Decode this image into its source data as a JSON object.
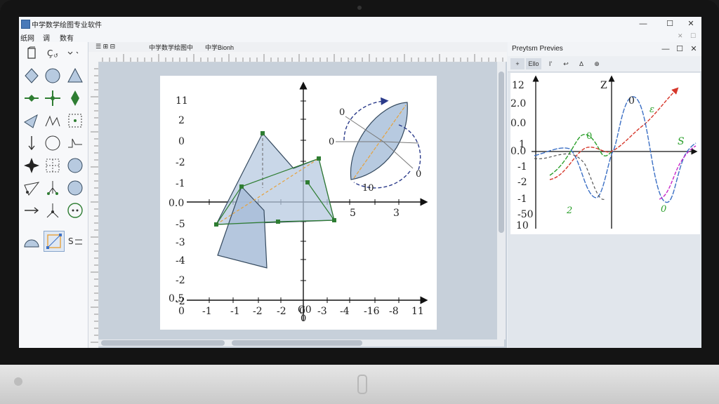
{
  "window": {
    "title": "中学数学绘图专业软件",
    "controls": {
      "minimize": "—",
      "maximize": "☐",
      "close": "✕"
    }
  },
  "menu": {
    "items": [
      "纸网",
      "调",
      "数有"
    ]
  },
  "doc": {
    "tabs": [
      "中学数学绘图中",
      "中学Bionh"
    ]
  },
  "tools": [
    "select-tool",
    "point-tool",
    "chevron-tool",
    "rhombus-tool",
    "circle-tool",
    "triangle-tool",
    "arrow-diamond-tool",
    "cross-tool",
    "diamond-tool",
    "parallelogram-tool",
    "angle-tool",
    "dotted-box-tool",
    "down-arrow-tool",
    "circle-outline-tool",
    "step-tool",
    "star-tool",
    "dashed-grid-tool",
    "filled-circle-tool",
    "triangle-outline-tool",
    "scatter-tool",
    "circle-tool-2",
    "right-arrow-tool",
    "branch-tool",
    "dotted-circle-tool",
    "semicircle-tool",
    "crop-tool",
    "transform-tool"
  ],
  "main_plot": {
    "y_labels_top": [
      "11",
      "2",
      "0",
      "-2",
      "-1",
      "0.0",
      "-5",
      "-3",
      "-4",
      "-2",
      "-2",
      "0.5"
    ],
    "x_labels_axis": [
      "5",
      "3"
    ],
    "x_labels_bottom": [
      "0",
      "-1",
      "-1",
      "-2",
      "-2",
      "0",
      "-3",
      "-4",
      "-16",
      "-8",
      "11"
    ],
    "x_label_zero": "0",
    "x_origin_label": "C0",
    "ellipse_labels": [
      "0",
      "0",
      "0",
      "10"
    ]
  },
  "preview": {
    "title": "Preytsm Previes",
    "tool_buttons": [
      "+",
      "Ello",
      "Ӏ'",
      "↩",
      "∆",
      "⊕"
    ],
    "y_labels": [
      "12",
      "2.0",
      "0.0",
      "1",
      "0.0",
      "-1",
      "-2",
      "-1",
      "-50",
      "10"
    ],
    "z_label": "Z",
    "curve_labels": {
      "top": "0",
      "green": "0",
      "red": "ε",
      "right": "S",
      "bottom_left": "2",
      "bottom_right": "0"
    }
  },
  "colors": {
    "fill": "#b7cae0",
    "stroke": "#34495e",
    "green": "#2e7d32",
    "orange": "#e6a23c",
    "blue_curve": "#3b6fc4",
    "red_curve": "#d6372b",
    "magenta_curve": "#c727c9",
    "green_curve": "#2ca02c",
    "dark_dash": "#555"
  }
}
